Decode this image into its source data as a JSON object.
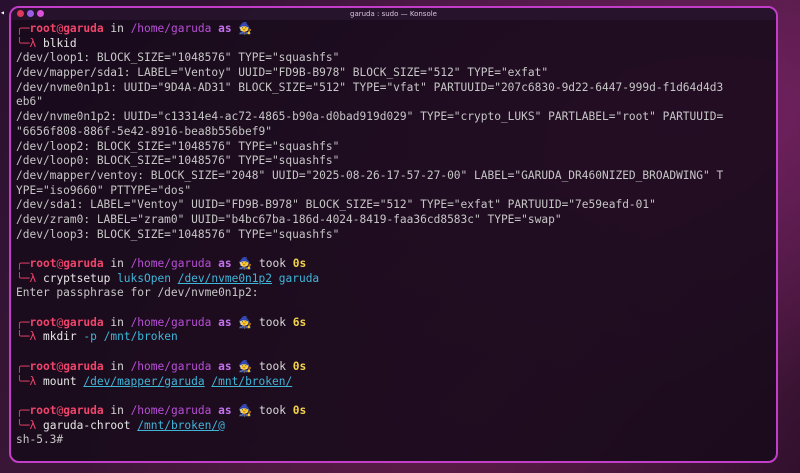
{
  "window": {
    "title": "garuda : sudo — Konsole"
  },
  "colors": {
    "accent_border": "#c23ec9",
    "prompt_red": "#f0446b",
    "path_purple": "#b84fd6",
    "duration_yellow": "#f2d44a",
    "arg_cyan": "#3fb6d8"
  },
  "icons": {
    "wizard": "🧙"
  },
  "prompt": {
    "user": "root",
    "at": "@",
    "host": "garuda",
    "in": " in ",
    "path": "/home/garuda",
    "as": " as ",
    "took": " took ",
    "corner_top": "╭─",
    "corner_bottom": "╰─",
    "lambda": "λ "
  },
  "blocks": [
    {
      "duration": "",
      "command": [
        {
          "t": "blkid",
          "c": "cmd"
        }
      ],
      "output": [
        "/dev/loop1: BLOCK_SIZE=\"1048576\" TYPE=\"squashfs\"",
        "/dev/mapper/sda1: LABEL=\"Ventoy\" UUID=\"FD9B-B978\" BLOCK_SIZE=\"512\" TYPE=\"exfat\"",
        "/dev/nvme0n1p1: UUID=\"9D4A-AD31\" BLOCK_SIZE=\"512\" TYPE=\"vfat\" PARTUUID=\"207c6830-9d22-6447-999d-f1d64d4d3",
        "eb6\"",
        "/dev/nvme0n1p2: UUID=\"c13314e4-ac72-4865-b90a-d0bad919d029\" TYPE=\"crypto_LUKS\" PARTLABEL=\"root\" PARTUUID=",
        "\"6656f808-886f-5e42-8916-bea8b556bef9\"",
        "/dev/loop2: BLOCK_SIZE=\"1048576\" TYPE=\"squashfs\"",
        "/dev/loop0: BLOCK_SIZE=\"1048576\" TYPE=\"squashfs\"",
        "/dev/mapper/ventoy: BLOCK_SIZE=\"2048\" UUID=\"2025-08-26-17-57-27-00\" LABEL=\"GARUDA_DR460NIZED_BROADWING\" T",
        "YPE=\"iso9660\" PTTYPE=\"dos\"",
        "/dev/sda1: LABEL=\"Ventoy\" UUID=\"FD9B-B978\" BLOCK_SIZE=\"512\" TYPE=\"exfat\" PARTUUID=\"7e59eafd-01\"",
        "/dev/zram0: LABEL=\"zram0\" UUID=\"b4bc67ba-186d-4024-8419-faa36cd8583c\" TYPE=\"swap\"",
        "/dev/loop3: BLOCK_SIZE=\"1048576\" TYPE=\"squashfs\""
      ]
    },
    {
      "duration": "0s",
      "command": [
        {
          "t": "cryptsetup ",
          "c": "cmd"
        },
        {
          "t": "luksOpen",
          "c": "arg"
        },
        {
          "t": " ",
          "c": "cmd"
        },
        {
          "t": "/dev/nvme0n1p2",
          "c": "arg-u"
        },
        {
          "t": " ",
          "c": "cmd"
        },
        {
          "t": "garuda",
          "c": "arg"
        }
      ],
      "output": [
        "Enter passphrase for /dev/nvme0n1p2:"
      ]
    },
    {
      "duration": "6s",
      "command": [
        {
          "t": "mkdir ",
          "c": "cmd"
        },
        {
          "t": "-p",
          "c": "flag"
        },
        {
          "t": " ",
          "c": "cmd"
        },
        {
          "t": "/mnt/broken",
          "c": "arg"
        }
      ],
      "output": []
    },
    {
      "duration": "0s",
      "command": [
        {
          "t": "mount ",
          "c": "cmd"
        },
        {
          "t": "/dev/mapper/garuda",
          "c": "arg-u"
        },
        {
          "t": " ",
          "c": "cmd"
        },
        {
          "t": "/mnt/broken/",
          "c": "arg-u"
        }
      ],
      "output": []
    },
    {
      "duration": "0s",
      "command": [
        {
          "t": "garuda-chroot ",
          "c": "cmd"
        },
        {
          "t": "/mnt/broken/@",
          "c": "arg-u"
        }
      ],
      "output": []
    }
  ],
  "shell_prompt": "sh-5.3#"
}
